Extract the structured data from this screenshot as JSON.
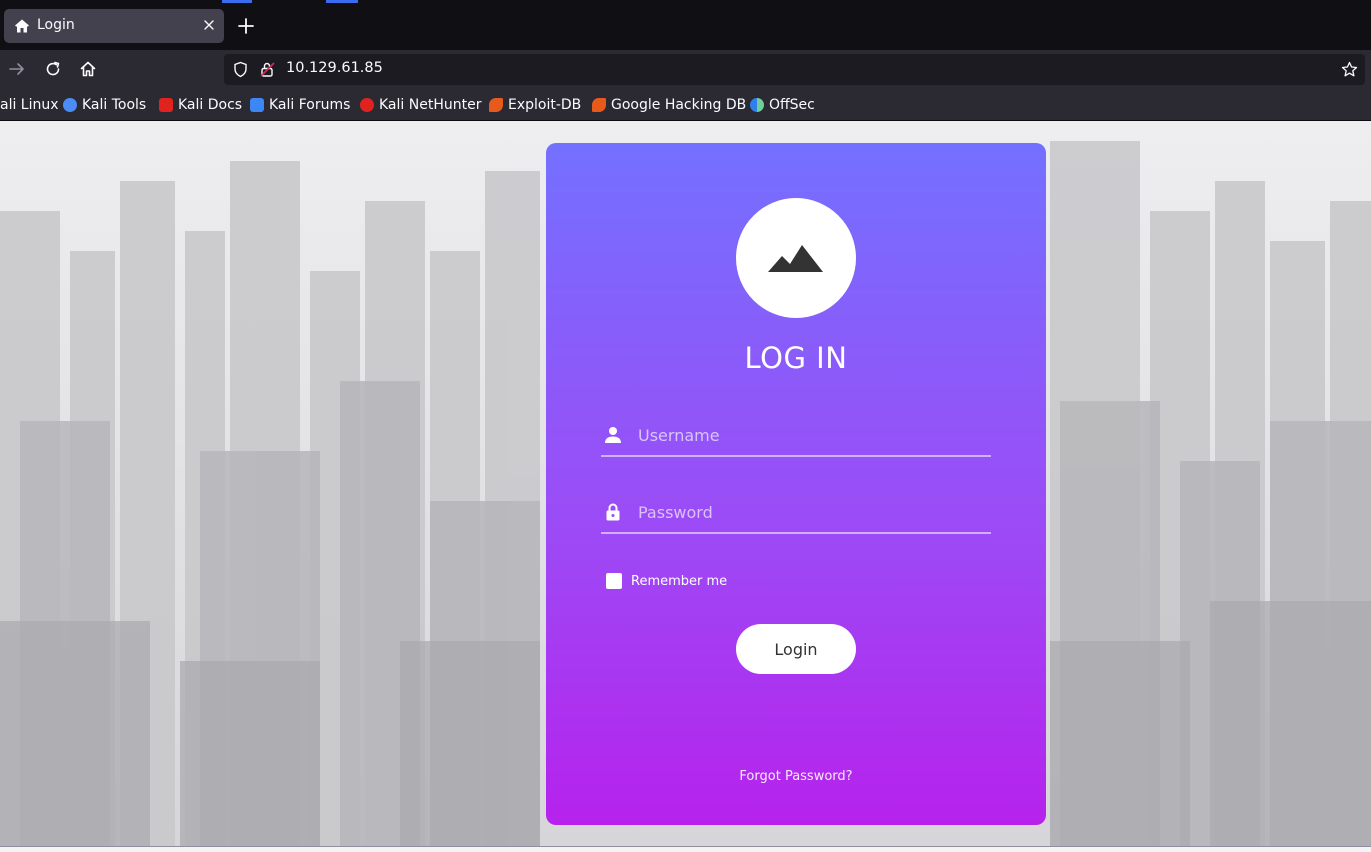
{
  "tab": {
    "title": "Login",
    "favicon": "home-icon"
  },
  "nav": {
    "url": "10.129.61.85"
  },
  "bookmarks": [
    {
      "label": "ali Linux",
      "icon": "kali-linux-icon",
      "color": "#367bf0"
    },
    {
      "label": "Kali Tools",
      "icon": "kali-tools-icon",
      "color": "#4c8cf5"
    },
    {
      "label": "Kali Docs",
      "icon": "kali-docs-icon",
      "color": "#e0231f"
    },
    {
      "label": "Kali Forums",
      "icon": "kali-forums-icon",
      "color": "#3d87f5"
    },
    {
      "label": "Kali NetHunter",
      "icon": "kali-nethunter-icon",
      "color": "#e0231f"
    },
    {
      "label": "Exploit-DB",
      "icon": "exploit-db-icon",
      "color": "#e85a1b"
    },
    {
      "label": "Google Hacking DB",
      "icon": "google-hacking-db-icon",
      "color": "#e85a1b"
    },
    {
      "label": "OffSec",
      "icon": "offsec-icon",
      "color": "#2f80ed"
    }
  ],
  "login": {
    "title": "LOG IN",
    "logo": "mountain-icon",
    "username_placeholder": "Username",
    "username_value": "",
    "password_placeholder": "Password",
    "password_value": "",
    "remember_label": "Remember me",
    "remember_checked": false,
    "button_label": "Login",
    "forgot_label": "Forgot Password?"
  },
  "colors": {
    "card_top": "#7470ff",
    "card_bottom": "#b622ec",
    "browser_chrome": "#2b2a33",
    "tab_strip": "#0f0f14"
  }
}
